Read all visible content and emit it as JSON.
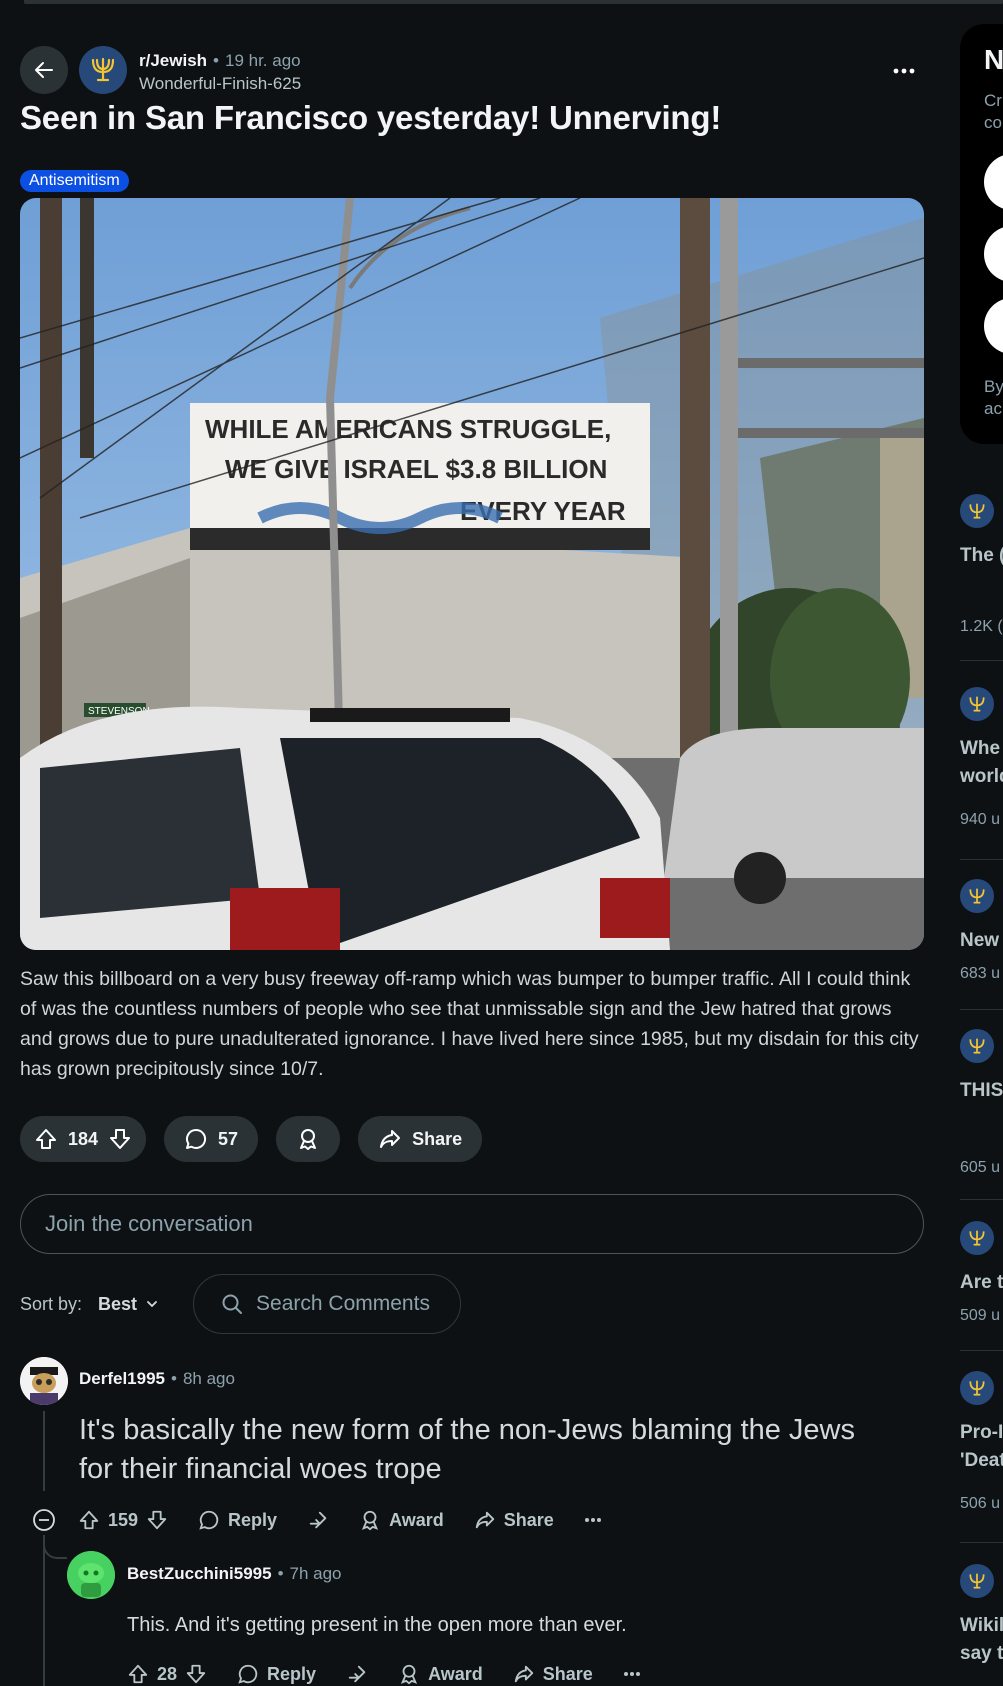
{
  "post": {
    "subreddit": "r/Jewish",
    "time": "19 hr. ago",
    "author": "Wonderful-Finish-625",
    "title": "Seen in San Francisco yesterday! Unnerving!",
    "flair": "Antisemitism",
    "image_billboard_line1": "WHILE AMERICANS STRUGGLE,",
    "image_billboard_line2": "WE GIVE ISRAEL $3.8 BILLION",
    "image_billboard_line3": "EVERY YEAR",
    "image_street_sign": "STEVENSON",
    "body": "Saw this billboard on a very busy freeway off-ramp which was bumper to bumper traffic. All I could think of was the countless numbers of people who see that unmissable sign and the Jew hatred that grows and grows due to pure unadulterated ignorance. I have lived here since 1985, but my disdain for this city has grown precipitously since 10/7.",
    "upvotes": "184",
    "comments": "57",
    "share_label": "Share"
  },
  "join_placeholder": "Join the conversation",
  "sort": {
    "label": "Sort by:",
    "value": "Best",
    "search_placeholder": "Search Comments"
  },
  "comments": [
    {
      "author": "Derfel1995",
      "time": "8h ago",
      "text": "It's basically the new form of the non-Jews blaming the Jews for their financial woes trope",
      "votes": "159",
      "reply": "Reply",
      "award": "Award",
      "share": "Share"
    },
    {
      "author": "BestZucchini5995",
      "time": "7h ago",
      "text": "This. And it's getting present in the open more than ever.",
      "votes": "28",
      "reply": "Reply",
      "award": "Award",
      "share": "Share"
    }
  ],
  "sidebar": {
    "card_title": "N",
    "card_line1": "Cr",
    "card_line2": "co",
    "card_foot1": "By",
    "card_foot2": "ac",
    "items": [
      {
        "title": "The (",
        "stat": "1.2K ("
      },
      {
        "title": "Whe",
        "title2": "world",
        "stat": "940 u"
      },
      {
        "title": "New",
        "stat": "683 u"
      },
      {
        "title": "THIS",
        "stat": "605 u"
      },
      {
        "title": "Are t",
        "stat": "509 u"
      },
      {
        "title": "Pro-I",
        "title2": "'Deat",
        "stat": "506 u"
      },
      {
        "title": "Wikil",
        "title2": "say t"
      }
    ]
  },
  "colors": {
    "background": "#0e1113",
    "flair": "#0b4fe3",
    "pill": "#2a3236",
    "accent_avatar": "#27497a"
  }
}
